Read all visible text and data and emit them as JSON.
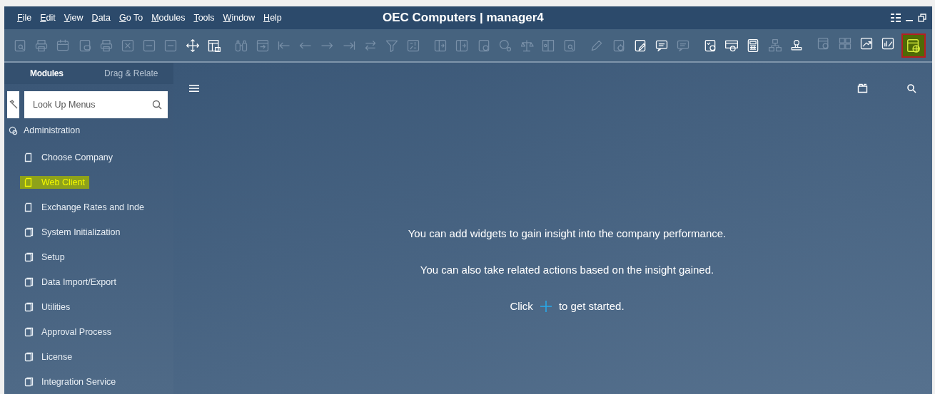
{
  "window": {
    "title": "OEC Computers | manager4"
  },
  "menu": [
    "File",
    "Edit",
    "View",
    "Data",
    "Go To",
    "Modules",
    "Tools",
    "Window",
    "Help"
  ],
  "toolbar": {
    "groups": [
      {
        "buttons": [
          {
            "disabled": true,
            "highlighted": false
          },
          {
            "disabled": true,
            "highlighted": false
          },
          {
            "disabled": true,
            "highlighted": false
          },
          {
            "disabled": true,
            "highlighted": false
          },
          {
            "disabled": true,
            "highlighted": false
          },
          {
            "disabled": true,
            "highlighted": false
          },
          {
            "disabled": true,
            "highlighted": false
          },
          {
            "disabled": true,
            "highlighted": false
          },
          {
            "disabled": false,
            "highlighted": false
          },
          {
            "disabled": false,
            "highlighted": false
          }
        ]
      },
      {
        "buttons": [
          {
            "disabled": true,
            "highlighted": false
          },
          {
            "disabled": true,
            "highlighted": false
          },
          {
            "disabled": true,
            "highlighted": false
          },
          {
            "disabled": true,
            "highlighted": false
          },
          {
            "disabled": true,
            "highlighted": false
          },
          {
            "disabled": true,
            "highlighted": false
          },
          {
            "disabled": true,
            "highlighted": false
          },
          {
            "disabled": true,
            "highlighted": false
          },
          {
            "disabled": true,
            "highlighted": false
          }
        ]
      },
      {
        "buttons": [
          {
            "disabled": true,
            "highlighted": false
          },
          {
            "disabled": true,
            "highlighted": false
          },
          {
            "disabled": true,
            "highlighted": false
          },
          {
            "disabled": true,
            "highlighted": false
          },
          {
            "disabled": true,
            "highlighted": false
          },
          {
            "disabled": true,
            "highlighted": false
          },
          {
            "disabled": true,
            "highlighted": false
          }
        ]
      },
      {
        "buttons": [
          {
            "disabled": true,
            "highlighted": false
          },
          {
            "disabled": true,
            "highlighted": false
          },
          {
            "disabled": false,
            "highlighted": false
          },
          {
            "disabled": false,
            "highlighted": false
          },
          {
            "disabled": true,
            "highlighted": false
          }
        ]
      },
      {
        "buttons": [
          {
            "disabled": false,
            "highlighted": false
          },
          {
            "disabled": false,
            "highlighted": false
          },
          {
            "disabled": false,
            "highlighted": false
          },
          {
            "disabled": true,
            "highlighted": false
          },
          {
            "disabled": false,
            "highlighted": false
          }
        ]
      },
      {
        "buttons": [
          {
            "disabled": true,
            "highlighted": false
          },
          {
            "disabled": true,
            "highlighted": false
          },
          {
            "disabled": false,
            "highlighted": false
          },
          {
            "disabled": false,
            "highlighted": false
          },
          {
            "disabled": false,
            "highlighted": true
          }
        ]
      }
    ]
  },
  "sidebar": {
    "tabs": [
      {
        "label": "Modules",
        "selected": true
      },
      {
        "label": "Drag & Relate",
        "selected": false
      }
    ],
    "search": {
      "placeholder": "Look Up Menus"
    },
    "tree": [
      {
        "label": "Administration",
        "children": [
          {
            "label": "Choose Company",
            "kind": "form",
            "highlighted": false
          },
          {
            "label": "Web Client",
            "kind": "form",
            "highlighted": true
          },
          {
            "label": "Exchange Rates and Inde",
            "kind": "form",
            "highlighted": false
          },
          {
            "label": "System Initialization",
            "kind": "folder",
            "highlighted": false
          },
          {
            "label": "Setup",
            "kind": "folder",
            "highlighted": false
          },
          {
            "label": "Data Import/Export",
            "kind": "folder",
            "highlighted": false
          },
          {
            "label": "Utilities",
            "kind": "folder",
            "highlighted": false
          },
          {
            "label": "Approval Process",
            "kind": "folder",
            "highlighted": false
          },
          {
            "label": "License",
            "kind": "folder",
            "highlighted": false
          },
          {
            "label": "Integration Service",
            "kind": "folder",
            "highlighted": false
          }
        ]
      }
    ]
  },
  "content": {
    "messages": [
      "You can add widgets to gain insight into the company performance.",
      "You can also take related actions based on the insight gained."
    ],
    "prompt": {
      "before": "Click",
      "after": "to get started."
    }
  }
}
